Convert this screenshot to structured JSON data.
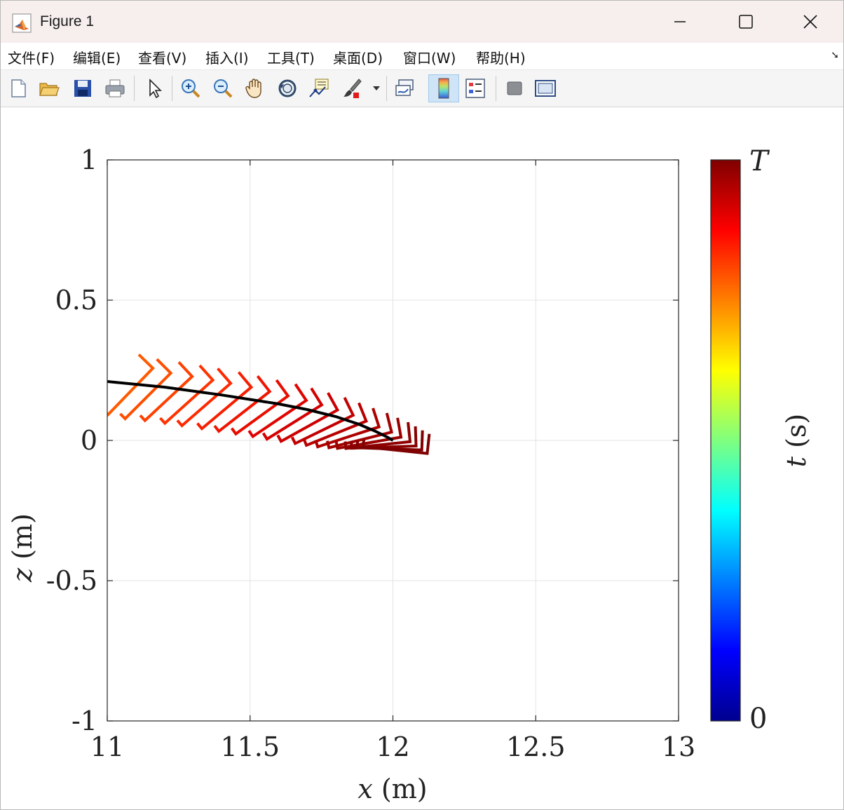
{
  "window": {
    "title": "Figure 1"
  },
  "menu": {
    "items": [
      "文件(F)",
      "编辑(E)",
      "查看(V)",
      "插入(I)",
      "工具(T)",
      "桌面(D)",
      "窗口(W)",
      "帮助(H)"
    ]
  },
  "toolbar": {
    "icons": [
      "new-figure-icon",
      "open-file-icon",
      "save-icon",
      "print-icon",
      "select-arrow-icon",
      "zoom-in-icon",
      "zoom-out-icon",
      "pan-hand-icon",
      "rotate-3d-icon",
      "data-cursor-icon",
      "brush-icon",
      "brush-dropdown-icon",
      "link-plot-icon",
      "colorbar-icon",
      "legend-icon",
      "hide-plot-tools-icon",
      "show-plot-tools-icon"
    ],
    "active": "colorbar-icon"
  },
  "chart_data": {
    "type": "line",
    "xlabel": "x (m)",
    "ylabel": "z (m)",
    "xlim": [
      11,
      13
    ],
    "ylim": [
      -1,
      1
    ],
    "xticks": [
      11,
      11.5,
      12,
      12.5,
      13
    ],
    "yticks": [
      -1,
      -0.5,
      0,
      0.5,
      1
    ],
    "xtick_labels": [
      "11",
      "11.5",
      "12",
      "12.5",
      "13"
    ],
    "ytick_labels": [
      "-1",
      "-0.5",
      "0",
      "0.5",
      "1"
    ],
    "grid": true,
    "colorbar": {
      "label": "t (s)",
      "top_label": "T",
      "bottom_label": "0",
      "colormap": "jet"
    },
    "trajectory": {
      "color": "#000000",
      "x": [
        11.0,
        11.2,
        11.4,
        11.6,
        11.7,
        11.8,
        11.88,
        11.94,
        11.98,
        12.0
      ],
      "z": [
        0.21,
        0.19,
        0.162,
        0.13,
        0.11,
        0.085,
        0.058,
        0.032,
        0.012,
        0.0
      ]
    },
    "frames": [
      {
        "x": 11.02,
        "z": 0.11,
        "angle": 46,
        "color": "#ff5a00"
      },
      {
        "x": 11.08,
        "z": 0.095,
        "angle": 45,
        "color": "#ff4d00"
      },
      {
        "x": 11.15,
        "z": 0.088,
        "angle": 43,
        "color": "#ff4000"
      },
      {
        "x": 11.22,
        "z": 0.078,
        "angle": 42,
        "color": "#ff3300"
      },
      {
        "x": 11.28,
        "z": 0.069,
        "angle": 41,
        "color": "#ff2800"
      },
      {
        "x": 11.35,
        "z": 0.058,
        "angle": 40,
        "color": "#f81e00"
      },
      {
        "x": 11.41,
        "z": 0.048,
        "angle": 38,
        "color": "#f01500"
      },
      {
        "x": 11.47,
        "z": 0.038,
        "angle": 36,
        "color": "#e80c00"
      },
      {
        "x": 11.53,
        "z": 0.028,
        "angle": 34,
        "color": "#e00400"
      },
      {
        "x": 11.58,
        "z": 0.018,
        "angle": 32,
        "color": "#d60000"
      },
      {
        "x": 11.63,
        "z": 0.009,
        "angle": 29,
        "color": "#cc0000"
      },
      {
        "x": 11.68,
        "z": 0.0,
        "angle": 26,
        "color": "#c20000"
      },
      {
        "x": 11.72,
        "z": -0.008,
        "angle": 22,
        "color": "#b80000"
      },
      {
        "x": 11.76,
        "z": -0.015,
        "angle": 18,
        "color": "#ae0000"
      },
      {
        "x": 11.8,
        "z": -0.02,
        "angle": 14,
        "color": "#a40000"
      },
      {
        "x": 11.83,
        "z": -0.024,
        "angle": 10,
        "color": "#9a0000"
      },
      {
        "x": 11.86,
        "z": -0.026,
        "angle": 6,
        "color": "#900000"
      },
      {
        "x": 11.88,
        "z": -0.027,
        "angle": 2,
        "color": "#880000"
      },
      {
        "x": 11.9,
        "z": -0.027,
        "angle": -2,
        "color": "#820000"
      },
      {
        "x": 11.92,
        "z": -0.025,
        "angle": -6,
        "color": "#7e0000"
      }
    ]
  }
}
